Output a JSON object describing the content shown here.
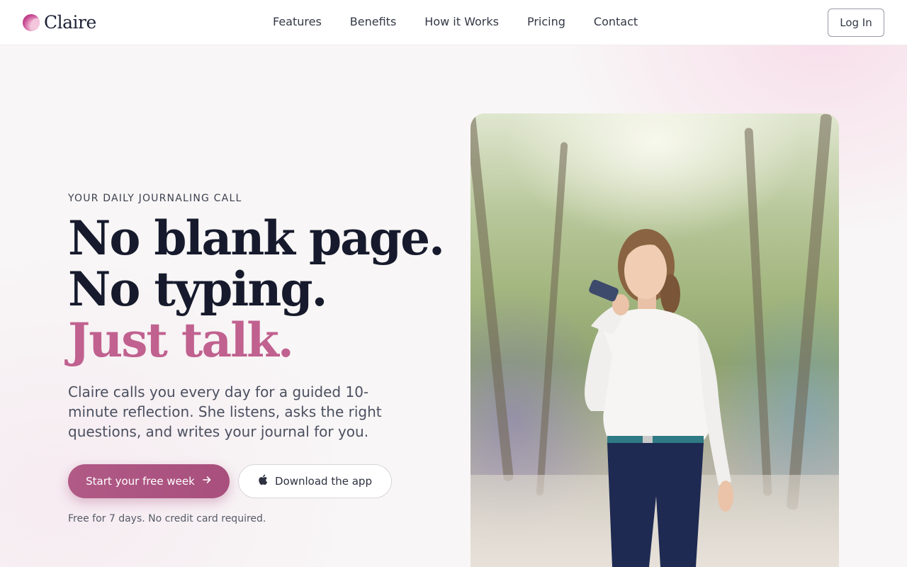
{
  "brand": {
    "name": "Claire",
    "logo_icon": "claire-logo-icon"
  },
  "nav": {
    "links": [
      {
        "label": "Features"
      },
      {
        "label": "Benefits"
      },
      {
        "label": "How it Works"
      },
      {
        "label": "Pricing"
      },
      {
        "label": "Contact"
      }
    ],
    "login_label": "Log In"
  },
  "hero": {
    "eyebrow": "YOUR DAILY JOURNALING CALL",
    "headline_line1": "No blank page.",
    "headline_line2": "No typing.",
    "headline_line3": "Just talk.",
    "subtext": "Claire calls you every day for a guided 10-minute reflection. She listens, asks the right questions, and writes your journal for you.",
    "primary_cta": {
      "label": "Start your free week",
      "icon": "arrow-right-icon"
    },
    "secondary_cta": {
      "label": "Download the app",
      "icon": "apple-icon"
    },
    "note": "Free for 7 days. No credit card required.",
    "image_icon": "woman-talking-on-phone-photo"
  },
  "colors": {
    "accent": "#c0618f",
    "primary_button": "#a84f7d",
    "heading": "#161a2c",
    "background": "#f8f6f6"
  }
}
